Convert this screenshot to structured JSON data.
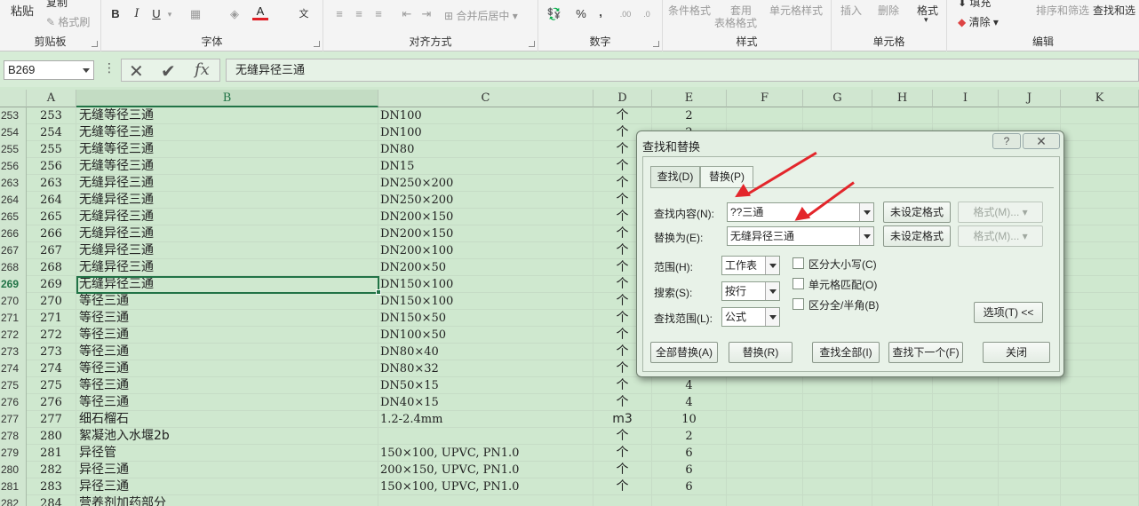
{
  "ribbon": {
    "clipboard": {
      "paste": "粘贴",
      "copy": "复制",
      "format_painter": "格式刷",
      "label": "剪贴板"
    },
    "font": {
      "bold": "B",
      "italic": "I",
      "underline": "U",
      "font_color": "A",
      "phonetic": "文",
      "label": "字体"
    },
    "alignment": {
      "merge_center": "合并后居中",
      "label": "对齐方式"
    },
    "number": {
      "percent": "%",
      "comma": ",",
      "label": "数字"
    },
    "styles": {
      "conditional": "条件格式",
      "table_apply": "套用",
      "table_format": "表格格式",
      "cell_styles": "单元格样式",
      "label": "样式"
    },
    "cells": {
      "insert": "插入",
      "delete": "删除",
      "format": "格式",
      "label": "单元格"
    },
    "editing": {
      "fill": "填充",
      "clear": "清除",
      "sort_filter": "排序和筛选",
      "find_select": "查找和选",
      "label": "编辑"
    }
  },
  "formula_bar": {
    "name_box": "B269",
    "dots": "⋮",
    "cancel": "✕",
    "enter": "✔",
    "fx": "fx",
    "content": "无缝异径三通"
  },
  "columns": [
    "A",
    "B",
    "C",
    "D",
    "E",
    "F",
    "G",
    "H",
    "I",
    "J",
    "K"
  ],
  "rows": [
    {
      "rn": "253",
      "a": "253",
      "b": "无缝等径三通",
      "c": "DN100",
      "d": "个",
      "e": "2"
    },
    {
      "rn": "254",
      "a": "254",
      "b": "无缝等径三通",
      "c": "DN100",
      "d": "个",
      "e": "2"
    },
    {
      "rn": "255",
      "a": "255",
      "b": "无缝等径三通",
      "c": "DN80",
      "d": "个",
      "e": ""
    },
    {
      "rn": "256",
      "a": "256",
      "b": "无缝等径三通",
      "c": "DN15",
      "d": "个",
      "e": ""
    },
    {
      "rn": "263",
      "a": "263",
      "b": "无缝异径三通",
      "c": "DN250×200",
      "d": "个",
      "e": ""
    },
    {
      "rn": "264",
      "a": "264",
      "b": "无缝异径三通",
      "c": "DN250×200",
      "d": "个",
      "e": ""
    },
    {
      "rn": "265",
      "a": "265",
      "b": "无缝异径三通",
      "c": "DN200×150",
      "d": "个",
      "e": ""
    },
    {
      "rn": "266",
      "a": "266",
      "b": "无缝异径三通",
      "c": "DN200×150",
      "d": "个",
      "e": ""
    },
    {
      "rn": "267",
      "a": "267",
      "b": "无缝异径三通",
      "c": "DN200×100",
      "d": "个",
      "e": ""
    },
    {
      "rn": "268",
      "a": "268",
      "b": "无缝异径三通",
      "c": "DN200×50",
      "d": "个",
      "e": ""
    },
    {
      "rn": "269",
      "a": "269",
      "b": "无缝异径三通",
      "c": "DN150×100",
      "d": "个",
      "e": "",
      "active": true
    },
    {
      "rn": "270",
      "a": "270",
      "b": "等径三通",
      "c": "DN150×100",
      "d": "个",
      "e": ""
    },
    {
      "rn": "271",
      "a": "271",
      "b": "等径三通",
      "c": "DN150×50",
      "d": "个",
      "e": ""
    },
    {
      "rn": "272",
      "a": "272",
      "b": "等径三通",
      "c": "DN100×50",
      "d": "个",
      "e": ""
    },
    {
      "rn": "273",
      "a": "273",
      "b": "等径三通",
      "c": "DN80×40",
      "d": "个",
      "e": ""
    },
    {
      "rn": "274",
      "a": "274",
      "b": "等径三通",
      "c": "DN80×32",
      "d": "个",
      "e": ""
    },
    {
      "rn": "275",
      "a": "275",
      "b": "等径三通",
      "c": "DN50×15",
      "d": "个",
      "e": "4"
    },
    {
      "rn": "276",
      "a": "276",
      "b": "等径三通",
      "c": "DN40×15",
      "d": "个",
      "e": "4"
    },
    {
      "rn": "277",
      "a": "277",
      "b": "细石榴石",
      "c": "1.2-2.4mm",
      "d": "m3",
      "e": "10"
    },
    {
      "rn": "278",
      "a": "280",
      "b": "絮凝池入水堰2b",
      "c": "",
      "d": "个",
      "e": "2"
    },
    {
      "rn": "279",
      "a": "281",
      "b": "异径管",
      "c": "150×100, UPVC, PN1.0",
      "d": "个",
      "e": "6"
    },
    {
      "rn": "280",
      "a": "282",
      "b": "异径三通",
      "c": "200×150, UPVC, PN1.0",
      "d": "个",
      "e": "6"
    },
    {
      "rn": "281",
      "a": "283",
      "b": "异径三通",
      "c": "150×100, UPVC, PN1.0",
      "d": "个",
      "e": "6"
    },
    {
      "rn": "282",
      "a": "284",
      "b": "营养剂加药部分",
      "c": "",
      "d": "",
      "e": ""
    }
  ],
  "dialog": {
    "title": "查找和替换",
    "help": "?",
    "close": "✕",
    "tab_find": "查找(D)",
    "tab_replace": "替换(P)",
    "find_label": "查找内容(N):",
    "find_value": "??三通",
    "replace_label": "替换为(E):",
    "replace_value": "无缝异径三通",
    "no_format_1": "未设定格式",
    "no_format_2": "未设定格式",
    "format_1": "格式(M)...",
    "format_2": "格式(M)...",
    "within_label": "范围(H):",
    "within_value": "工作表",
    "search_label": "搜索(S):",
    "search_value": "按行",
    "lookin_label": "查找范围(L):",
    "lookin_value": "公式",
    "match_case": "区分大小写(C)",
    "match_entire": "单元格匹配(O)",
    "match_width": "区分全/半角(B)",
    "options": "选项(T) <<",
    "replace_all": "全部替换(A)",
    "replace": "替换(R)",
    "find_all": "查找全部(I)",
    "find_next": "查找下一个(F)",
    "close_button": "关闭"
  }
}
